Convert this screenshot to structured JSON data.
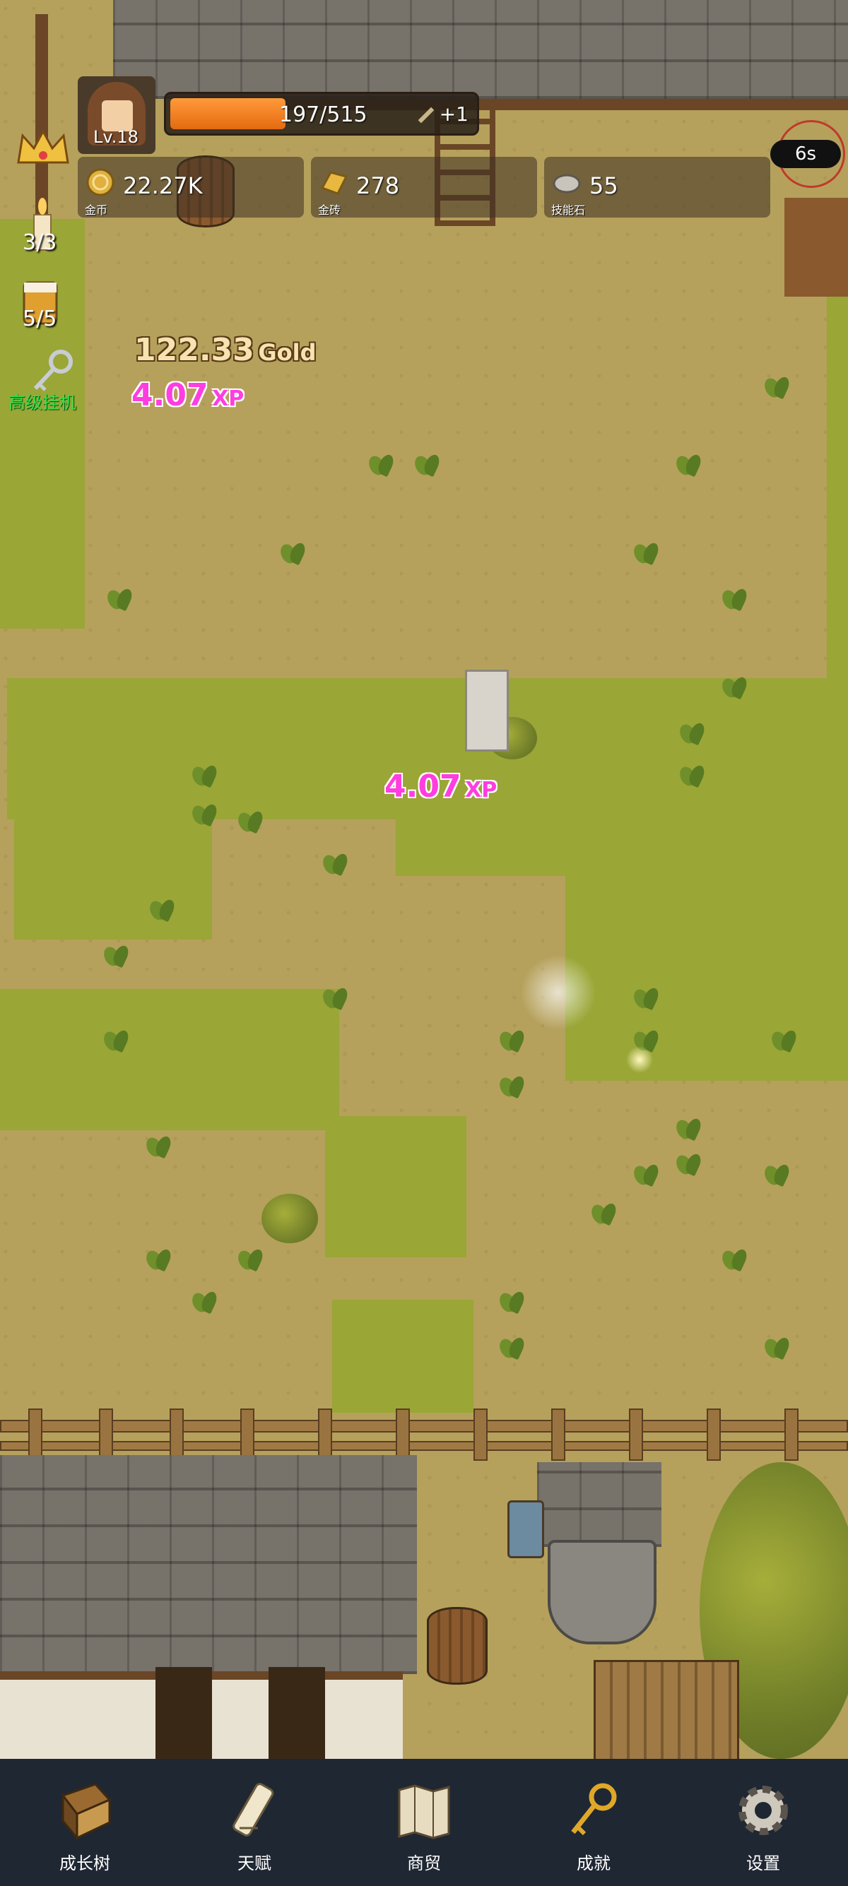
{
  "hud": {
    "level": "Lv.18",
    "xp_text": "197/515",
    "xp_progress": 0.38,
    "xp_bonus": "+1",
    "timer": "6s"
  },
  "resources": [
    {
      "icon": "gold-coin-icon",
      "value": "22.27K",
      "label": "金币"
    },
    {
      "icon": "gold-brick-icon",
      "value": "278",
      "label": "金砖"
    },
    {
      "icon": "skill-stone-icon",
      "value": "55",
      "label": "技能石"
    }
  ],
  "sidebar": {
    "candle_count": "3/3",
    "mug_count": "5/5",
    "auto_label": "高级挂机"
  },
  "floating": {
    "gold_value": "122.33",
    "gold_unit": "Gold",
    "xp1_value": "4.07",
    "xp1_unit": "XP",
    "xp2_value": "4.07",
    "xp2_unit": "XP"
  },
  "nav": [
    {
      "label": "成长树",
      "icon": "growth-book-icon"
    },
    {
      "label": "天赋",
      "icon": "talent-scroll-icon"
    },
    {
      "label": "商贸",
      "icon": "trade-map-icon"
    },
    {
      "label": "成就",
      "icon": "achievement-key-icon"
    },
    {
      "label": "设置",
      "icon": "settings-gear-icon"
    }
  ],
  "colors": {
    "xp_fill": "#f08020",
    "auto_label": "#37e04a",
    "xp_float": "#ff3de0",
    "nav_bg": "#1f2733"
  }
}
